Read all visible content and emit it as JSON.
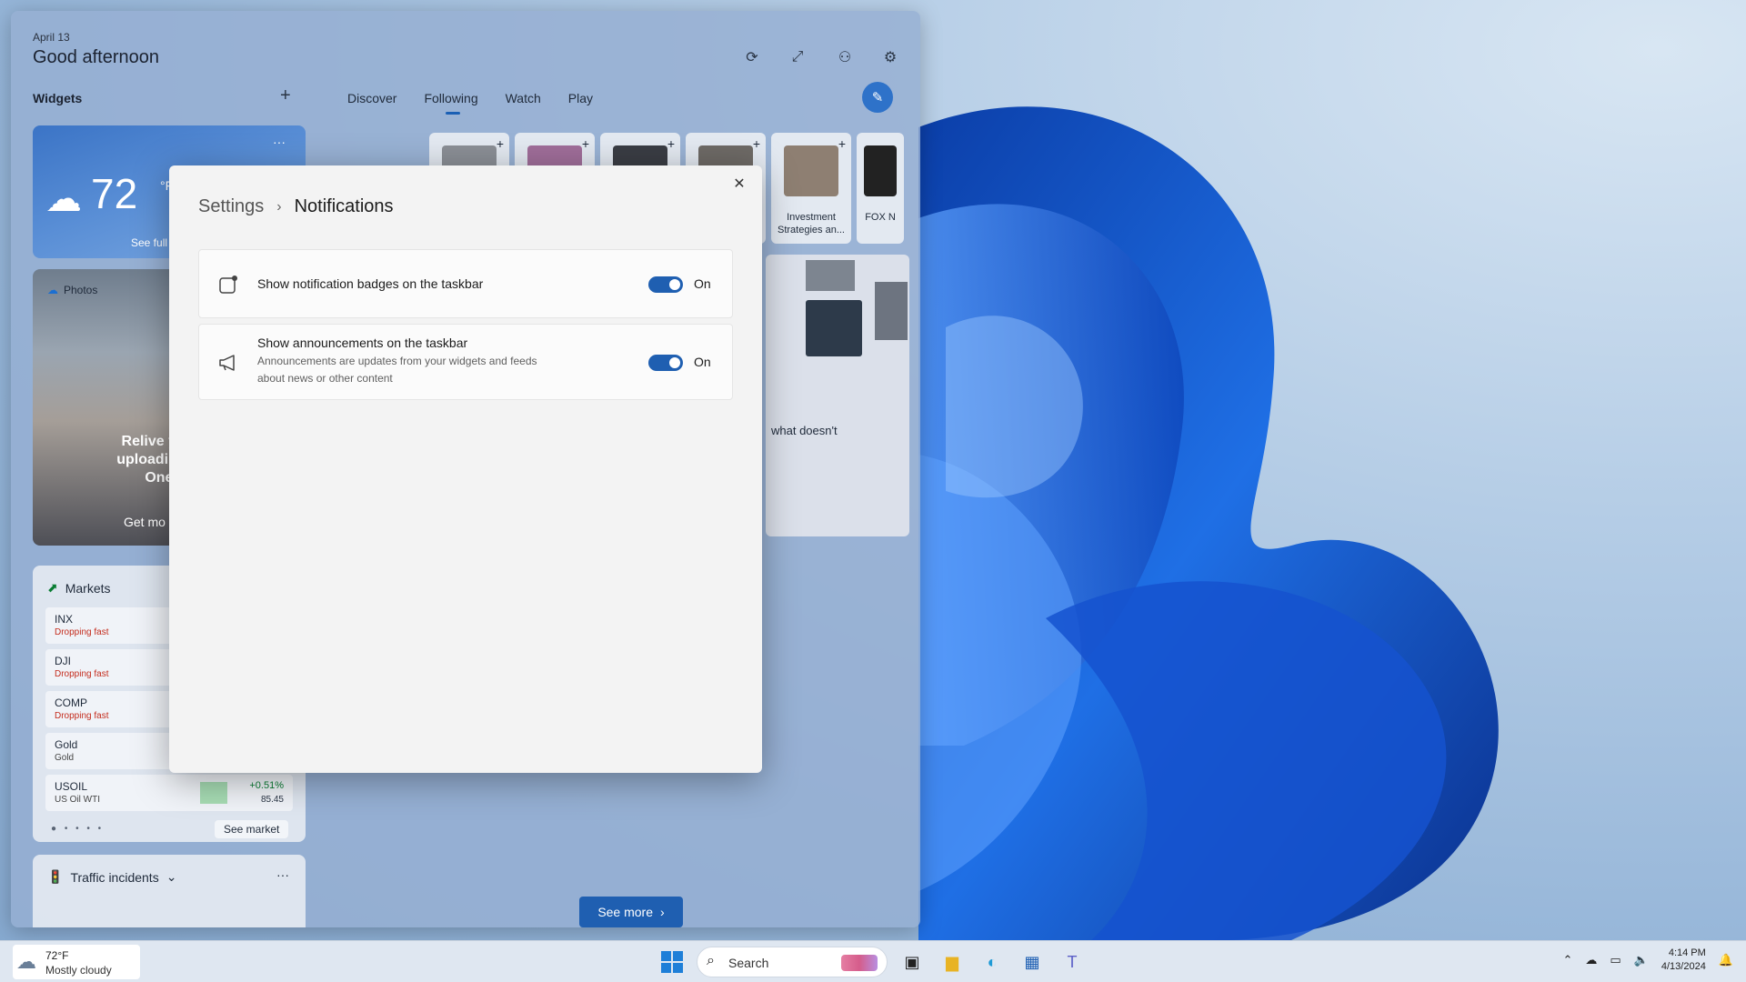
{
  "widgets_board": {
    "date": "April 13",
    "greeting": "Good afternoon",
    "widgets_label": "Widgets",
    "add_widget": "+",
    "tabs": [
      {
        "label": "Discover"
      },
      {
        "label": "Following"
      },
      {
        "label": "Watch"
      },
      {
        "label": "Play"
      }
    ],
    "active_tab": "Following"
  },
  "weather_widget": {
    "temp": "72",
    "unit": "°F",
    "see_full": "See full",
    "more": "···"
  },
  "photos_widget": {
    "title": "Photos",
    "body_lines": [
      "Relive your m",
      "uploading your",
      "OneDri"
    ],
    "cta": "Get mo"
  },
  "markets_widget": {
    "title": "Markets",
    "rows": [
      {
        "symbol": "INX",
        "sub": "Dropping fast"
      },
      {
        "symbol": "DJI",
        "sub": "Dropping fast"
      },
      {
        "symbol": "COMP",
        "sub": "Dropping fast"
      },
      {
        "symbol": "Gold",
        "sub": "Gold"
      },
      {
        "symbol": "USOIL",
        "sub": "US Oil WTI",
        "change": "+0.51%",
        "price": "85.45"
      }
    ],
    "see_market": "See market"
  },
  "traffic_widget": {
    "title": "Traffic incidents",
    "more": "···"
  },
  "feed": {
    "thumbs": [
      {
        "caption": ""
      },
      {
        "caption": ""
      },
      {
        "caption": ""
      },
      {
        "caption": ""
      },
      {
        "caption": "Investment Strategies an..."
      },
      {
        "caption": "FOX N"
      }
    ],
    "snippet": "what doesn't",
    "see_more": "See more"
  },
  "dialog": {
    "breadcrumb_root": "Settings",
    "breadcrumb_current": "Notifications",
    "settings": [
      {
        "label": "Show notification badges on the taskbar",
        "state": "On",
        "on": true
      },
      {
        "label": "Show announcements on the taskbar",
        "description": "Announcements are updates from your widgets and feeds about news or other content",
        "state": "On",
        "on": true
      }
    ]
  },
  "taskbar": {
    "weather_temp": "72°F",
    "weather_desc": "Mostly cloudy",
    "search_placeholder": "Search",
    "time": "4:14 PM",
    "date": "4/13/2024"
  },
  "colors": {
    "accent": "#1f5fb1",
    "windows_blue": "#1e7fd8",
    "positive": "#0a7d33",
    "negative": "#c42b1c"
  },
  "icons": [
    "refresh-icon",
    "expand-icon",
    "personalize-icon",
    "gear-icon",
    "close-icon",
    "chevron-right-icon",
    "badge-icon",
    "megaphone-icon",
    "search-icon"
  ]
}
